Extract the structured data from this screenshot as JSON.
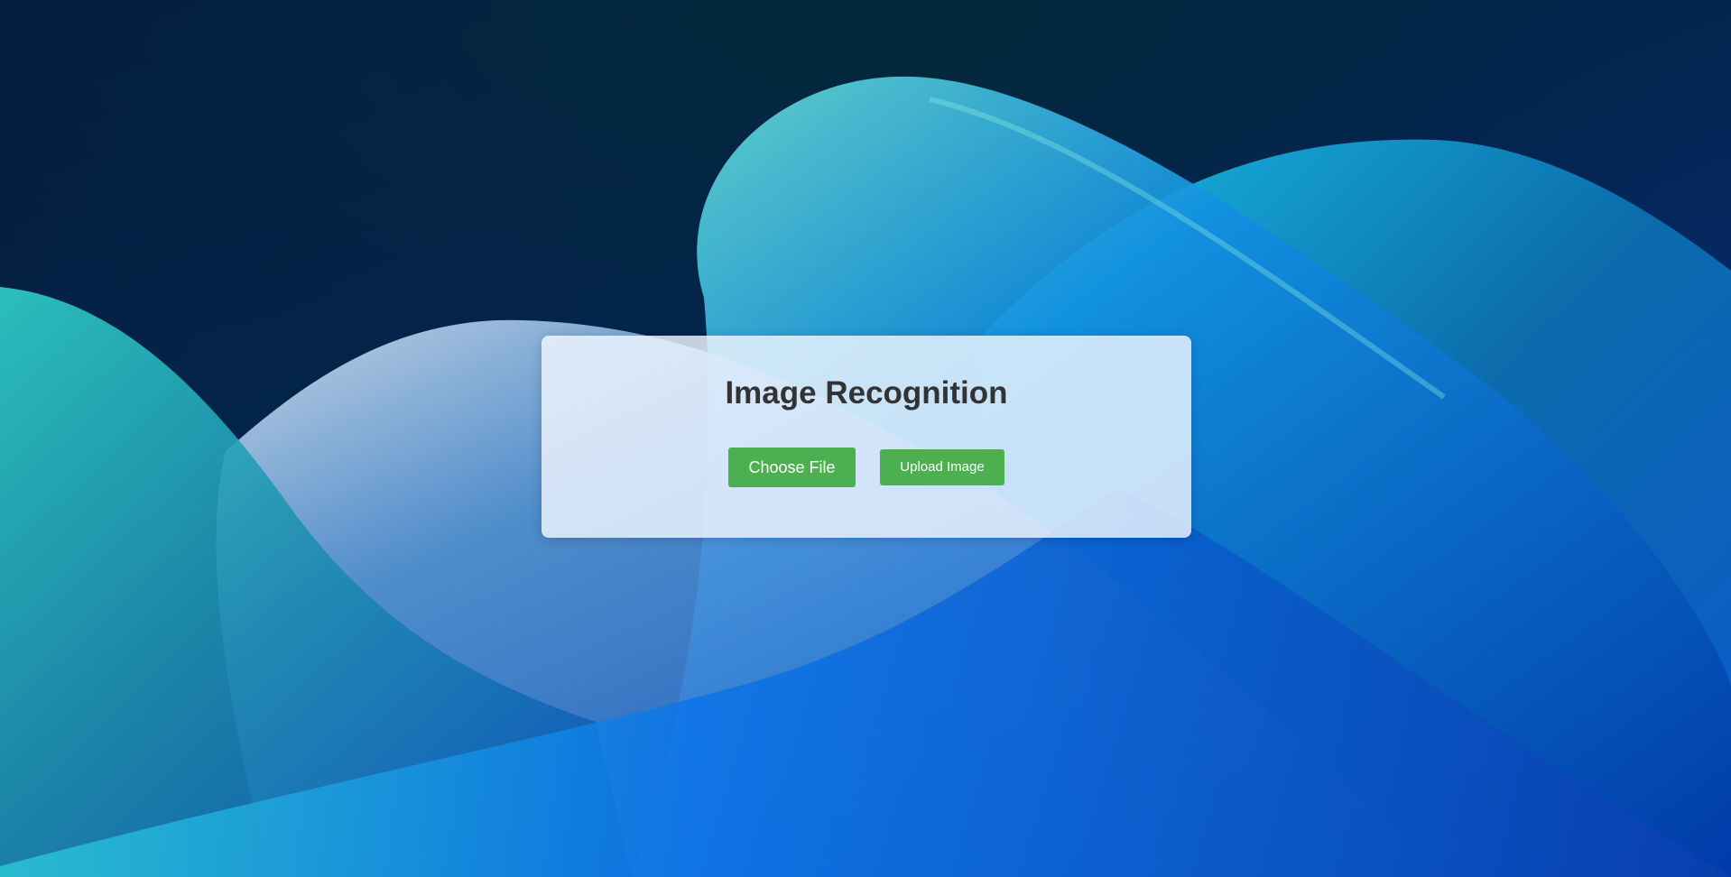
{
  "page": {
    "title": "Image Recognition"
  },
  "form": {
    "choose_file_label": "Choose File",
    "upload_label": "Upload Image"
  },
  "colors": {
    "button_bg": "#4caf50",
    "title_text": "#333333",
    "card_bg": "#f0f6ff"
  }
}
